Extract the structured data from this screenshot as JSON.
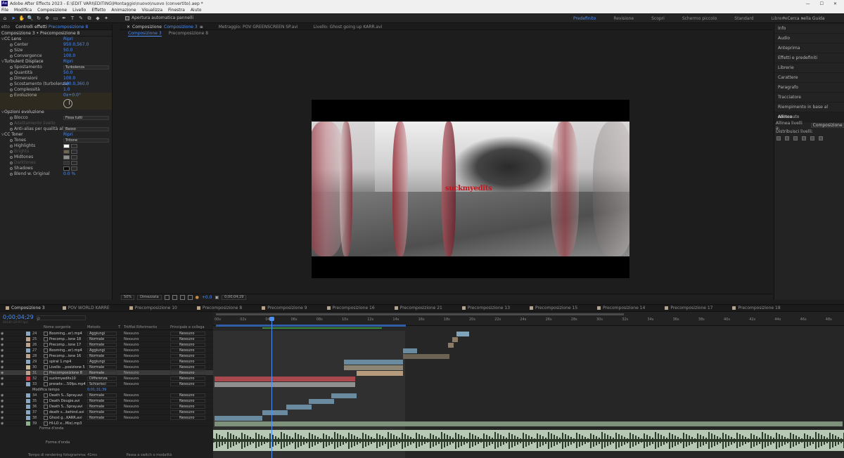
{
  "titlebar": {
    "app_icon": "Ae",
    "title": "Adobe After Effects 2023 - E:\\EDIT VARI\\EDITING\\Montaggio\\nuovo\\nuovo (convertito).aep *",
    "minimize": "—",
    "maximize": "☐",
    "close": "✕"
  },
  "menu": [
    "File",
    "Modifica",
    "Composizione",
    "Livello",
    "Effetto",
    "Animazione",
    "Visualizza",
    "Finestra",
    "Aiuto"
  ],
  "toolbar": {
    "tools": [
      "⌂",
      "➤",
      "✋",
      "🔍",
      "↻",
      "✥",
      "▭",
      "✒",
      "T",
      "✎",
      "⧉",
      "◆",
      "✦"
    ],
    "snap_label": "Apertura automatica pannelli",
    "workspaces": [
      "Predefinito",
      "Revisione",
      "Scopri",
      "Schermo piccolo",
      "Standard",
      "Librerie"
    ],
    "active_workspace": "Predefinito",
    "more": "»",
    "search_label": "Cerca nella Guida"
  },
  "effects_panel": {
    "tab_project": "etto",
    "tab_effects_prefix": "Controlli effetti",
    "tab_effects_target": "Precomposizione 8",
    "header": "Composizione 3 • Precomposizione 8",
    "effects": [
      {
        "name": "CC Lens",
        "reset": "Ripri",
        "params": [
          {
            "label": "Center",
            "value": "950.0,567.0",
            "kind": "point"
          },
          {
            "label": "Size",
            "value": "50.0",
            "kind": "num"
          },
          {
            "label": "Convergence",
            "value": "100.0",
            "kind": "num"
          }
        ]
      },
      {
        "name": "Turbulent Displace",
        "reset": "Ripri",
        "params": [
          {
            "label": "Spostamento",
            "value": "Turbolenza",
            "kind": "dd"
          },
          {
            "label": "Quantità",
            "value": "50.0",
            "kind": "num"
          },
          {
            "label": "Dimensioni",
            "value": "100.0",
            "kind": "num"
          },
          {
            "label": "Scostamento (turbolenza)",
            "value": "640.0,360.0",
            "kind": "point"
          },
          {
            "label": "Complessità",
            "value": "1.0",
            "kind": "num"
          },
          {
            "label": "Evoluzione",
            "value": "0x+0.0°",
            "kind": "num"
          }
        ]
      },
      {
        "name": "Opzioni evoluzione",
        "reset": "",
        "params": [
          {
            "label": "Blocco",
            "value": "Fissa tutti",
            "kind": "dd"
          },
          {
            "label": "Adattamento livello",
            "value": "",
            "kind": "chk-disabled"
          },
          {
            "label": "Anti-alias per qualità alta",
            "value": "Basso",
            "kind": "dd"
          }
        ]
      },
      {
        "name": "CC Toner",
        "reset": "Ripri",
        "params": [
          {
            "label": "Tones",
            "value": "Tritone",
            "kind": "dd"
          },
          {
            "label": "Highlights",
            "value": "#f5f5f5",
            "kind": "color"
          },
          {
            "label": "Brights",
            "value": "#e6c89a",
            "kind": "color-disabled"
          },
          {
            "label": "Midtones",
            "value": "#8c8c8c",
            "kind": "color"
          },
          {
            "label": "Darktones",
            "value": "#5c4a38",
            "kind": "color-disabled"
          },
          {
            "label": "Shadows",
            "value": "#0a0a0a",
            "kind": "color"
          },
          {
            "label": "Blend w. Original",
            "value": "0.0 %",
            "kind": "num"
          }
        ]
      }
    ]
  },
  "comp_panel": {
    "tabs": [
      {
        "label": "Composizione",
        "target": "Composizione 3",
        "menu": "≡"
      },
      {
        "label": "Metraggio: POV GREENSCREEN SP.avi",
        "target": "",
        "menu": ""
      },
      {
        "label": "Livello: Ghost going up KARR.avi",
        "target": "",
        "menu": ""
      }
    ],
    "crumbs": [
      "Composizione 3",
      "Precomposizione 8"
    ],
    "watermark": "suckmyedits",
    "viewer_bar": {
      "zoom": "50%",
      "quality": "Dimezzata",
      "exposure": "+0.0",
      "timecode": "0;00;04;29"
    }
  },
  "right_panel": {
    "items": [
      "Info",
      "Audio",
      "Anteprima",
      "Effetti e predefiniti",
      "Librerie",
      "Carattere",
      "Paragrafo",
      "Tracciatore",
      "Riempimento in base al contenuto"
    ],
    "align_title": "Allinea",
    "align_label": "Allinea livelli a:",
    "align_value": "Composizione",
    "distribute_label": "Distribuisci livelli:"
  },
  "timeline": {
    "tabs": [
      "Composizione 3",
      "POV WORLD KARRE",
      "Precomposizione 10",
      "Precomposizione 8",
      "Precomposizione 9",
      "Precomposizione 16",
      "Precomposizione 21",
      "Precomposizione 13",
      "Precomposizione 15",
      "Precomposizione 14",
      "Precomposizione 17",
      "Precomposizione 18"
    ],
    "active_tab": "Composizione 3",
    "timecode": "0;00;04;29",
    "fps": "00149 (29.97 fps)",
    "search_placeholder": "ρ",
    "columns": [
      "Nome sorgente",
      "Metodo",
      "T",
      "TrkMat",
      "Riferimento",
      "Principale e collega"
    ],
    "ruler": [
      "00s",
      "02s",
      "04s",
      "06s",
      "08s",
      "10s",
      "12s",
      "14s",
      "16s",
      "18s",
      "20s",
      "22s",
      "24s",
      "26s",
      "28s",
      "30s",
      "32s",
      "34s",
      "36s",
      "38s",
      "40s",
      "42s",
      "44s",
      "46s",
      "48s"
    ],
    "layers": [
      {
        "num": "24",
        "name": "Booming...er).mp4",
        "mode": "Aggiungi",
        "trk": "Nessuno",
        "parent": "Nessuno",
        "label": "#8aa7c2",
        "sel": false
      },
      {
        "num": "25",
        "name": "Precomp...ione 18",
        "mode": "Normale",
        "trk": "Nessuno",
        "parent": "Nessuno",
        "label": "#b9a38c",
        "sel": false
      },
      {
        "num": "26",
        "name": "Precomp...ione 17",
        "mode": "Normale",
        "trk": "Nessuno",
        "parent": "Nessuno",
        "label": "#b9a38c",
        "sel": false
      },
      {
        "num": "27",
        "name": "Booming...er).mp4",
        "mode": "Aggiungi",
        "trk": "Nessuno",
        "parent": "Nessuno",
        "label": "#8aa7c2",
        "sel": false
      },
      {
        "num": "28",
        "name": "Precomp...ione 16",
        "mode": "Normale",
        "trk": "Nessuno",
        "parent": "Nessuno",
        "label": "#b9a38c",
        "sel": false
      },
      {
        "num": "29",
        "name": "spiral 1.mp4",
        "mode": "Aggiungi",
        "trk": "Nessuno",
        "parent": "Nessuno",
        "label": "#8aa7c2",
        "sel": false
      },
      {
        "num": "30",
        "name": "Livello ...posizione 5",
        "mode": "Normale",
        "trk": "Nessuno",
        "parent": "Nessuno",
        "label": "#c7b99a",
        "sel": false
      },
      {
        "num": "31",
        "name": "Precomposizione 8",
        "mode": "Normale",
        "trk": "Nessuno",
        "parent": "Nessuno",
        "label": "#b9a38c",
        "sel": true
      },
      {
        "num": "32",
        "name": "suckmyedits10",
        "mode": "Differenza",
        "trk": "Nessuno",
        "parent": "Nessuno",
        "label": "#c8404a",
        "sel": false
      },
      {
        "num": "33",
        "name": "presets-...50fps.mp4",
        "mode": "Schiarisci",
        "trk": "Nessuno",
        "parent": "Nessuno",
        "label": "#8aa7c2",
        "sel": false
      },
      {
        "num": "34",
        "name": "Death S...Spray.avi",
        "mode": "Normale",
        "trk": "Nessuno",
        "parent": "Nessuno",
        "label": "#8aa7c2",
        "sel": false
      },
      {
        "num": "35",
        "name": "Death Dougie.avi",
        "mode": "Normale",
        "trk": "Nessuno",
        "parent": "Nessuno",
        "label": "#8aa7c2",
        "sel": false
      },
      {
        "num": "36",
        "name": "Death S...Spray.avi",
        "mode": "Normale",
        "trk": "Nessuno",
        "parent": "Nessuno",
        "label": "#8aa7c2",
        "sel": false
      },
      {
        "num": "37",
        "name": "death s...behind.avi",
        "mode": "Normale",
        "trk": "Nessuno",
        "parent": "Nessuno",
        "label": "#8aa7c2",
        "sel": false
      },
      {
        "num": "38",
        "name": "Ghost g...KARR.avi",
        "mode": "Normale",
        "trk": "Nessuno",
        "parent": "Nessuno",
        "label": "#8aa7c2",
        "sel": false
      },
      {
        "num": "39",
        "name": "HI-LO x...Mix).mp3",
        "mode": "",
        "trk": "",
        "parent": "",
        "label": "#8fb08c",
        "sel": false
      }
    ],
    "time_remap_label": "Modifica tempo",
    "time_remap_value": "0;01;31;39",
    "form_label": "Forma d'onda",
    "wave_label": "Forma d'onda",
    "footer_left": "Tempo di rendering fotogramma: 41ms",
    "footer_mid": "Passa a switch o modalità"
  }
}
